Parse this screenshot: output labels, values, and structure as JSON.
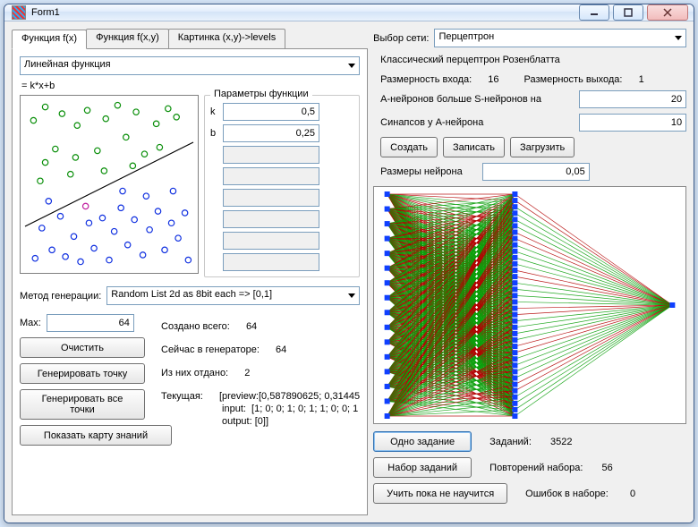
{
  "window": {
    "title": "Form1"
  },
  "tabs": {
    "t1": "Функция f(x)",
    "t2": "Функция f(x,y)",
    "t3": "Картинка (x,y)->levels"
  },
  "func": {
    "selector": "Линейная функция",
    "formula": "= k*x+b",
    "params_legend": "Параметры функции",
    "k_label": "k",
    "k_val": "0,5",
    "b_label": "b",
    "b_val": "0,25"
  },
  "gen": {
    "method_label": "Метод генерации:",
    "method_val": "Random List 2d as 8bit each => [0,1]",
    "max_label": "Max:",
    "max_val": "64",
    "clear": "Очистить",
    "gen_point": "Генерировать точку",
    "gen_all": "Генерировать все точки",
    "show_map": "Показать карту знаний",
    "created_label": "Создано всего:",
    "created_val": "64",
    "in_gen_label": "Сейчас в генераторе:",
    "in_gen_val": "64",
    "given_label": "Из них отдано:",
    "given_val": "2",
    "current_label": "Текущая:",
    "current_val": "[preview:[0,587890625; 0,31445\n input:  [1; 0; 0; 1; 0; 1; 1; 0; 0; 1\n output: [0]]"
  },
  "net": {
    "choose_label": "Выбор сети:",
    "choose_val": "Перцептрон",
    "subtitle": "Классический перцептрон Розенблатта",
    "in_label": "Размерность входа:",
    "in_val": "16",
    "out_label": "Размерность выхода:",
    "out_val": "1",
    "a_more_s_label": "А-нейронов больше S-нейронов на",
    "a_more_s_val": "20",
    "syn_label": "Синапсов у А-нейрона",
    "syn_val": "10",
    "create": "Создать",
    "save": "Записать",
    "load": "Загрузить",
    "neuron_size_label": "Размеры нейрона",
    "neuron_size_val": "0,05",
    "one_task": "Одно задание",
    "tasks_label": "Заданий:",
    "tasks_val": "3522",
    "task_set": "Набор заданий",
    "rep_label": "Повторений набора:",
    "rep_val": "56",
    "learn": "Учить пока не научится",
    "err_label": "Ошибок в наборе:",
    "err_val": "0"
  },
  "chart_data": {
    "scatter": {
      "type": "scatter",
      "xlim": [
        0,
        1
      ],
      "ylim": [
        0,
        1
      ],
      "line": {
        "k": 0.5,
        "b": 0.25
      },
      "points_green": [
        [
          0.05,
          0.88
        ],
        [
          0.09,
          0.52
        ],
        [
          0.12,
          0.96
        ],
        [
          0.18,
          0.71
        ],
        [
          0.22,
          0.92
        ],
        [
          0.27,
          0.56
        ],
        [
          0.31,
          0.85
        ],
        [
          0.37,
          0.94
        ],
        [
          0.43,
          0.7
        ],
        [
          0.48,
          0.89
        ],
        [
          0.55,
          0.97
        ],
        [
          0.6,
          0.78
        ],
        [
          0.66,
          0.93
        ],
        [
          0.71,
          0.68
        ],
        [
          0.78,
          0.86
        ],
        [
          0.85,
          0.95
        ],
        [
          0.9,
          0.9
        ],
        [
          0.12,
          0.63
        ],
        [
          0.3,
          0.66
        ],
        [
          0.64,
          0.61
        ],
        [
          0.8,
          0.72
        ],
        [
          0.47,
          0.58
        ]
      ],
      "points_blue": [
        [
          0.06,
          0.06
        ],
        [
          0.1,
          0.24
        ],
        [
          0.16,
          0.11
        ],
        [
          0.21,
          0.31
        ],
        [
          0.24,
          0.07
        ],
        [
          0.29,
          0.19
        ],
        [
          0.33,
          0.04
        ],
        [
          0.38,
          0.27
        ],
        [
          0.41,
          0.12
        ],
        [
          0.46,
          0.3
        ],
        [
          0.5,
          0.05
        ],
        [
          0.53,
          0.22
        ],
        [
          0.57,
          0.36
        ],
        [
          0.61,
          0.14
        ],
        [
          0.65,
          0.29
        ],
        [
          0.7,
          0.08
        ],
        [
          0.74,
          0.23
        ],
        [
          0.79,
          0.34
        ],
        [
          0.83,
          0.11
        ],
        [
          0.87,
          0.27
        ],
        [
          0.91,
          0.18
        ],
        [
          0.95,
          0.33
        ],
        [
          0.97,
          0.05
        ],
        [
          0.14,
          0.4
        ],
        [
          0.58,
          0.46
        ],
        [
          0.72,
          0.43
        ],
        [
          0.88,
          0.46
        ]
      ],
      "highlight": [
        0.36,
        0.37
      ]
    },
    "network": {
      "type": "network",
      "columns": [
        {
          "x": 0.02,
          "count": 16,
          "color": "#1040ff"
        },
        {
          "x": 0.45,
          "count": 36,
          "color": "#1040ff"
        },
        {
          "x": 0.98,
          "count": 1,
          "color": "#1040ff"
        }
      ],
      "layer01_red_ratio": 0.28,
      "layer12_red_ratio": 0.2
    }
  }
}
